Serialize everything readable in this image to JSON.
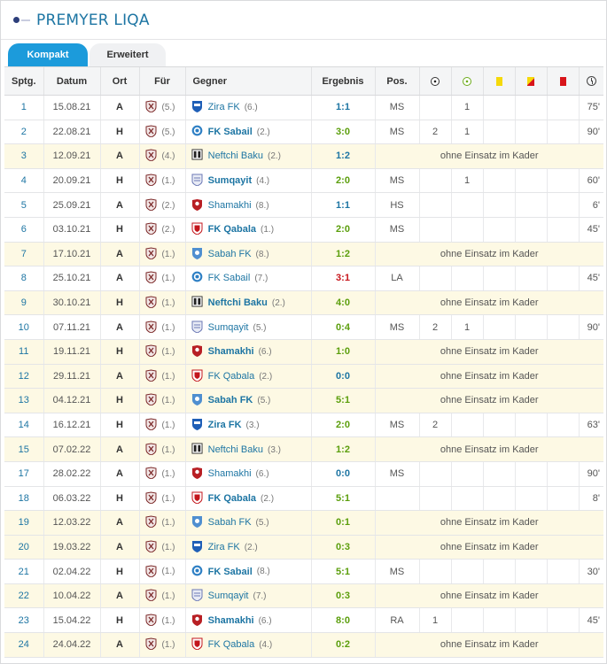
{
  "header": {
    "title": "PREMYER LIQA"
  },
  "tabs": [
    {
      "label": "Kompakt",
      "active": true
    },
    {
      "label": "Erweitert",
      "active": false
    }
  ],
  "columns": {
    "spieltag": "Sptg.",
    "datum": "Datum",
    "ort": "Ort",
    "fur": "Für",
    "gegner": "Gegner",
    "ergebnis": "Ergebnis",
    "pos": "Pos.",
    "icons": [
      "ball-icon",
      "assist-icon",
      "yellow-card-icon",
      "yellow-red-card-icon",
      "red-card-icon",
      "clock-icon"
    ]
  },
  "colors": {
    "accent": "#1c9bdb",
    "link": "#1d75a3",
    "win": "#5b9e0c",
    "lose": "#c7161c",
    "highlight": "#fdf9e4"
  },
  "rows": [
    {
      "sptg": "1",
      "datum": "15.08.21",
      "ort": "A",
      "fur_rank": "(5.)",
      "gegner": "Zira FK",
      "gegner_rank": "(6.)",
      "crest": "zira",
      "ergebnis": "1:1",
      "res": "draw",
      "pos": "MS",
      "tore": "",
      "vorlagen": "1",
      "minuten": "75'",
      "ohne": ""
    },
    {
      "sptg": "2",
      "datum": "22.08.21",
      "ort": "H",
      "fur_rank": "(5.)",
      "gegner": "FK Sabail",
      "gegner_rank": "(2.)",
      "crest": "sabail",
      "ergebnis": "3:0",
      "res": "win",
      "pos": "MS",
      "tore": "2",
      "vorlagen": "1",
      "minuten": "90'",
      "ohne": ""
    },
    {
      "sptg": "3",
      "datum": "12.09.21",
      "ort": "A",
      "fur_rank": "(4.)",
      "gegner": "Neftchi Baku",
      "gegner_rank": "(2.)",
      "crest": "neftchi",
      "ergebnis": "1:2",
      "res": "draw",
      "pos": "",
      "tore": "",
      "vorlagen": "",
      "minuten": "",
      "ohne": "ohne Einsatz im Kader"
    },
    {
      "sptg": "4",
      "datum": "20.09.21",
      "ort": "H",
      "fur_rank": "(1.)",
      "gegner": "Sumqayit",
      "gegner_rank": "(4.)",
      "crest": "sumqayit",
      "ergebnis": "2:0",
      "res": "win",
      "pos": "MS",
      "tore": "",
      "vorlagen": "1",
      "minuten": "60'",
      "ohne": ""
    },
    {
      "sptg": "5",
      "datum": "25.09.21",
      "ort": "A",
      "fur_rank": "(2.)",
      "gegner": "Shamakhi",
      "gegner_rank": "(8.)",
      "crest": "shamakhi",
      "ergebnis": "1:1",
      "res": "draw",
      "pos": "HS",
      "tore": "",
      "vorlagen": "",
      "minuten": "6'",
      "ohne": ""
    },
    {
      "sptg": "6",
      "datum": "03.10.21",
      "ort": "H",
      "fur_rank": "(2.)",
      "gegner": "FK Qabala",
      "gegner_rank": "(1.)",
      "crest": "qabala",
      "ergebnis": "2:0",
      "res": "win",
      "pos": "MS",
      "tore": "",
      "vorlagen": "",
      "minuten": "45'",
      "ohne": ""
    },
    {
      "sptg": "7",
      "datum": "17.10.21",
      "ort": "A",
      "fur_rank": "(1.)",
      "gegner": "Sabah FK",
      "gegner_rank": "(8.)",
      "crest": "sabah",
      "ergebnis": "1:2",
      "res": "win",
      "pos": "",
      "tore": "",
      "vorlagen": "",
      "minuten": "",
      "ohne": "ohne Einsatz im Kader"
    },
    {
      "sptg": "8",
      "datum": "25.10.21",
      "ort": "A",
      "fur_rank": "(1.)",
      "gegner": "FK Sabail",
      "gegner_rank": "(7.)",
      "crest": "sabail",
      "ergebnis": "3:1",
      "res": "lose",
      "pos": "LA",
      "tore": "",
      "vorlagen": "",
      "minuten": "45'",
      "ohne": ""
    },
    {
      "sptg": "9",
      "datum": "30.10.21",
      "ort": "H",
      "fur_rank": "(1.)",
      "gegner": "Neftchi Baku",
      "gegner_rank": "(2.)",
      "crest": "neftchi",
      "ergebnis": "4:0",
      "res": "win",
      "pos": "",
      "tore": "",
      "vorlagen": "",
      "minuten": "",
      "ohne": "ohne Einsatz im Kader"
    },
    {
      "sptg": "10",
      "datum": "07.11.21",
      "ort": "A",
      "fur_rank": "(1.)",
      "gegner": "Sumqayit",
      "gegner_rank": "(5.)",
      "crest": "sumqayit",
      "ergebnis": "0:4",
      "res": "win",
      "pos": "MS",
      "tore": "2",
      "vorlagen": "1",
      "minuten": "90'",
      "ohne": ""
    },
    {
      "sptg": "11",
      "datum": "19.11.21",
      "ort": "H",
      "fur_rank": "(1.)",
      "gegner": "Shamakhi",
      "gegner_rank": "(6.)",
      "crest": "shamakhi",
      "ergebnis": "1:0",
      "res": "win",
      "pos": "",
      "tore": "",
      "vorlagen": "",
      "minuten": "",
      "ohne": "ohne Einsatz im Kader"
    },
    {
      "sptg": "12",
      "datum": "29.11.21",
      "ort": "A",
      "fur_rank": "(1.)",
      "gegner": "FK Qabala",
      "gegner_rank": "(2.)",
      "crest": "qabala",
      "ergebnis": "0:0",
      "res": "draw",
      "pos": "",
      "tore": "",
      "vorlagen": "",
      "minuten": "",
      "ohne": "ohne Einsatz im Kader"
    },
    {
      "sptg": "13",
      "datum": "04.12.21",
      "ort": "H",
      "fur_rank": "(1.)",
      "gegner": "Sabah FK",
      "gegner_rank": "(5.)",
      "crest": "sabah",
      "ergebnis": "5:1",
      "res": "win",
      "pos": "",
      "tore": "",
      "vorlagen": "",
      "minuten": "",
      "ohne": "ohne Einsatz im Kader"
    },
    {
      "sptg": "14",
      "datum": "16.12.21",
      "ort": "H",
      "fur_rank": "(1.)",
      "gegner": "Zira FK",
      "gegner_rank": "(3.)",
      "crest": "zira",
      "ergebnis": "2:0",
      "res": "win",
      "pos": "MS",
      "tore": "2",
      "vorlagen": "",
      "minuten": "63'",
      "ohne": ""
    },
    {
      "sptg": "15",
      "datum": "07.02.22",
      "ort": "A",
      "fur_rank": "(1.)",
      "gegner": "Neftchi Baku",
      "gegner_rank": "(3.)",
      "crest": "neftchi",
      "ergebnis": "1:2",
      "res": "win",
      "pos": "",
      "tore": "",
      "vorlagen": "",
      "minuten": "",
      "ohne": "ohne Einsatz im Kader"
    },
    {
      "sptg": "17",
      "datum": "28.02.22",
      "ort": "A",
      "fur_rank": "(1.)",
      "gegner": "Shamakhi",
      "gegner_rank": "(6.)",
      "crest": "shamakhi",
      "ergebnis": "0:0",
      "res": "draw",
      "pos": "MS",
      "tore": "",
      "vorlagen": "",
      "minuten": "90'",
      "ohne": ""
    },
    {
      "sptg": "18",
      "datum": "06.03.22",
      "ort": "H",
      "fur_rank": "(1.)",
      "gegner": "FK Qabala",
      "gegner_rank": "(2.)",
      "crest": "qabala",
      "ergebnis": "5:1",
      "res": "win",
      "pos": "",
      "tore": "",
      "vorlagen": "",
      "minuten": "8'",
      "ohne": ""
    },
    {
      "sptg": "19",
      "datum": "12.03.22",
      "ort": "A",
      "fur_rank": "(1.)",
      "gegner": "Sabah FK",
      "gegner_rank": "(5.)",
      "crest": "sabah",
      "ergebnis": "0:1",
      "res": "win",
      "pos": "",
      "tore": "",
      "vorlagen": "",
      "minuten": "",
      "ohne": "ohne Einsatz im Kader"
    },
    {
      "sptg": "20",
      "datum": "19.03.22",
      "ort": "A",
      "fur_rank": "(1.)",
      "gegner": "Zira FK",
      "gegner_rank": "(2.)",
      "crest": "zira",
      "ergebnis": "0:3",
      "res": "win",
      "pos": "",
      "tore": "",
      "vorlagen": "",
      "minuten": "",
      "ohne": "ohne Einsatz im Kader"
    },
    {
      "sptg": "21",
      "datum": "02.04.22",
      "ort": "H",
      "fur_rank": "(1.)",
      "gegner": "FK Sabail",
      "gegner_rank": "(8.)",
      "crest": "sabail",
      "ergebnis": "5:1",
      "res": "win",
      "pos": "MS",
      "tore": "",
      "vorlagen": "",
      "minuten": "30'",
      "ohne": ""
    },
    {
      "sptg": "22",
      "datum": "10.04.22",
      "ort": "A",
      "fur_rank": "(1.)",
      "gegner": "Sumqayit",
      "gegner_rank": "(7.)",
      "crest": "sumqayit",
      "ergebnis": "0:3",
      "res": "win",
      "pos": "",
      "tore": "",
      "vorlagen": "",
      "minuten": "",
      "ohne": "ohne Einsatz im Kader"
    },
    {
      "sptg": "23",
      "datum": "15.04.22",
      "ort": "H",
      "fur_rank": "(1.)",
      "gegner": "Shamakhi",
      "gegner_rank": "(6.)",
      "crest": "shamakhi",
      "ergebnis": "8:0",
      "res": "win",
      "pos": "RA",
      "tore": "1",
      "vorlagen": "",
      "minuten": "45'",
      "ohne": ""
    },
    {
      "sptg": "24",
      "datum": "24.04.22",
      "ort": "A",
      "fur_rank": "(1.)",
      "gegner": "FK Qabala",
      "gegner_rank": "(4.)",
      "crest": "qabala",
      "ergebnis": "0:2",
      "res": "win",
      "pos": "",
      "tore": "",
      "vorlagen": "",
      "minuten": "",
      "ohne": "ohne Einsatz im Kader"
    }
  ]
}
